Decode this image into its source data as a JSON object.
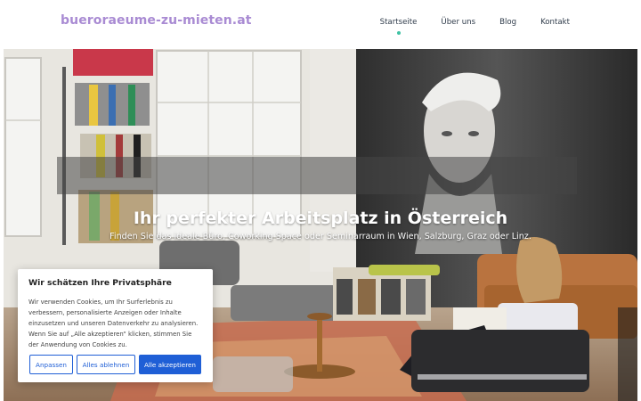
{
  "header": {
    "logo": "bueroraeume-zu-mieten.at",
    "nav": [
      {
        "label": "Startseite",
        "active": true
      },
      {
        "label": "Über uns",
        "active": false
      },
      {
        "label": "Blog",
        "active": false
      },
      {
        "label": "Kontakt",
        "active": false
      }
    ]
  },
  "hero": {
    "title": "Ihr perfekter Arbeitsplatz in Österreich",
    "subtitle": "Finden Sie das ideale Büro, Coworking Space oder Seminarraum in Wien, Salzburg, Graz oder Linz."
  },
  "cookie_banner": {
    "title": "Wir schätzen Ihre Privatsphäre",
    "text": "Wir verwenden Cookies, um Ihr Surferlebnis zu verbessern, personalisierte Anzeigen oder Inhalte einzusetzen und unseren Datenverkehr zu analysieren. Wenn Sie auf „Alle akzeptieren“ klicken, stimmen Sie der Anwendung von Cookies zu.",
    "buttons": {
      "customize": "Anpassen",
      "reject": "Alles ablehnen",
      "accept": "Alle akzeptieren"
    }
  },
  "colors": {
    "logo": "#a98bd3",
    "nav_active_dot": "#3fc2a4",
    "primary_button": "#1f5fd6"
  }
}
